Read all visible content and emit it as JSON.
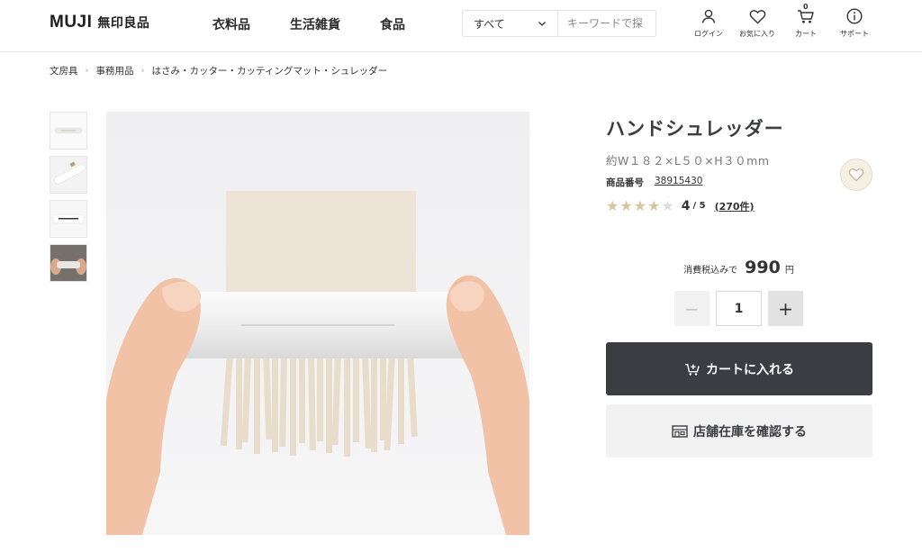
{
  "header": {
    "logo_en": "MUJI",
    "logo_jp": "無印良品",
    "nav": [
      "衣料品",
      "生活雑貨",
      "食品"
    ],
    "search": {
      "category": "すべて",
      "placeholder": "キーワードで探"
    },
    "icons": [
      {
        "icon": "user-icon",
        "label": "ログイン"
      },
      {
        "icon": "heart-icon",
        "label": "お気に入り"
      },
      {
        "icon": "cart-icon",
        "label": "カート",
        "count": "0"
      },
      {
        "icon": "info-icon",
        "label": "サポート"
      }
    ]
  },
  "breadcrumb": [
    "文房具",
    "事務用品",
    "はさみ・カッター・カッティングマット・シュレッダー"
  ],
  "product": {
    "title": "ハンドシュレッダー",
    "size": "約W１８２×L５０×H３０mm",
    "code_label": "商品番号",
    "code": "38915430",
    "rating": "4",
    "rating_max": "/ 5",
    "rating_stars": 4,
    "reviews": "(270件)",
    "price_label": "消費税込みで",
    "price": "990",
    "currency": "円",
    "quantity": "1",
    "qty_minus": "−",
    "qty_plus": "+",
    "add_to_cart": "カートに入れる",
    "check_store": "店舗在庫を確認する"
  },
  "colors": {
    "dark": "#3c3c43",
    "star": "#d6c49a",
    "fav_bg": "#f6efe3"
  }
}
